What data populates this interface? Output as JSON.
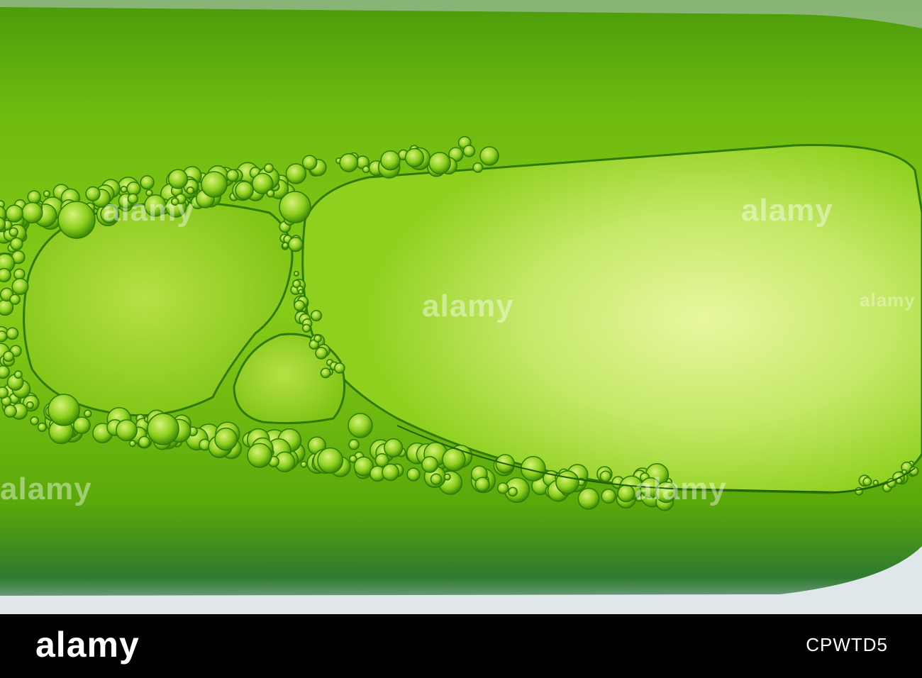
{
  "image": {
    "subject": "",
    "colors": {
      "liquid_dark": "#3f8d05",
      "liquid_mid": "#77c00c",
      "liquid_light": "#d8f08a",
      "bubble_edge": "#2f7a06",
      "footer_bg": "#000000",
      "footer_text": "#ffffff"
    }
  },
  "watermarks": {
    "brand": "alamy"
  },
  "footer": {
    "logo": "alamy",
    "image_id": "CPWTD5"
  }
}
